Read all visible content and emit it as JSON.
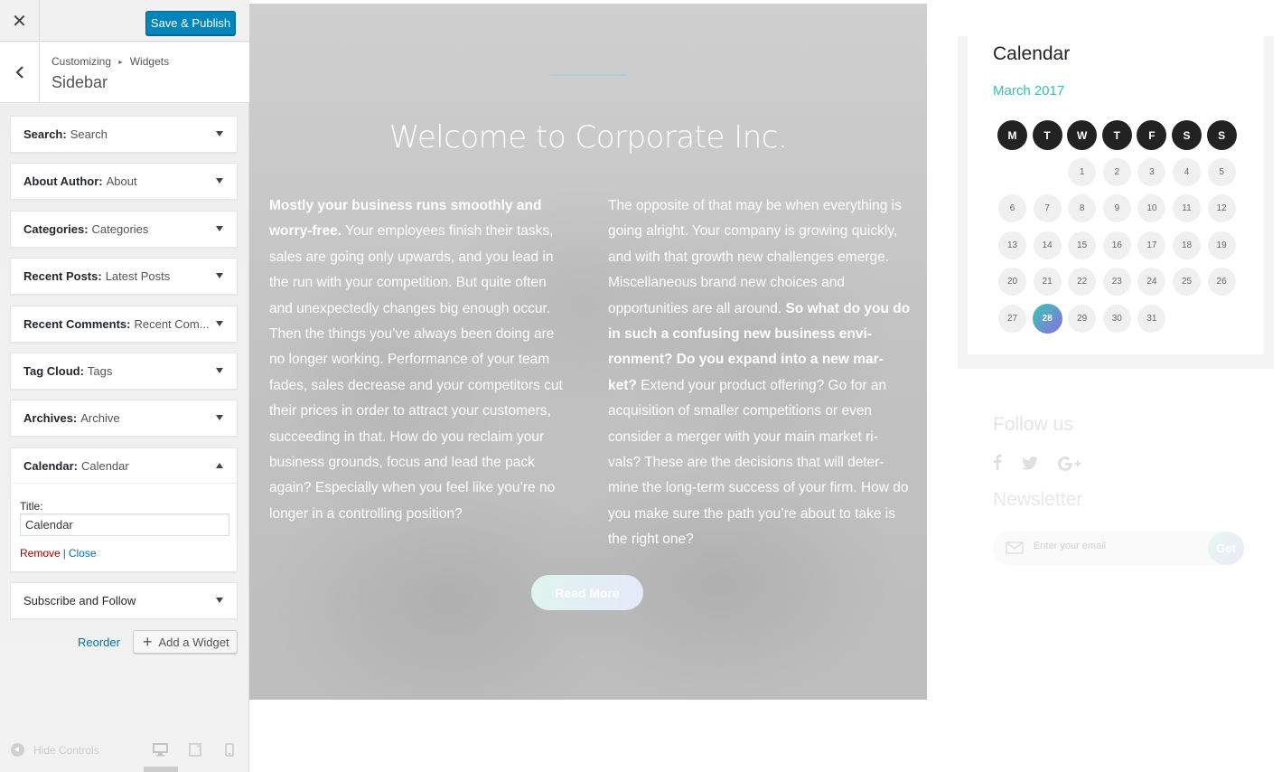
{
  "customizer": {
    "publish_label": "Save & Publish",
    "breadcrumb_customizing": "Customizing",
    "breadcrumb_widgets": "Widgets",
    "section_title": "Sidebar",
    "widgets": [
      {
        "type": "Search:",
        "title": "Search"
      },
      {
        "type": "About Author:",
        "title": "About"
      },
      {
        "type": "Categories:",
        "title": "Categories"
      },
      {
        "type": "Recent Posts:",
        "title": "Latest Posts"
      },
      {
        "type": "Recent Comments:",
        "title": "Recent Com..."
      },
      {
        "type": "Tag Cloud:",
        "title": "Tags"
      },
      {
        "type": "Archives:",
        "title": "Archive"
      },
      {
        "type": "Calendar:",
        "title": "Calendar"
      },
      {
        "type": "Subscribe and Follow",
        "title": ""
      }
    ],
    "calendar_form": {
      "title_label": "Title:",
      "title_value": "Calendar",
      "remove_label": "Remove",
      "separator": "|",
      "close_label": "Close"
    },
    "reorder_label": "Reorder",
    "add_widget_label": "Add a Widget",
    "hide_controls_label": "Hide Controls"
  },
  "hero": {
    "title": "Welcome to Corporate Inc.",
    "left_bold": "Mostly your business runs smoothly and worry-free.",
    "left_text": " Your employees finish their tasks, sales are going only upwards, and you lead in the run with your competition. But quite often and unexpectedly changes big enough occur. Then the things you’ve always been doing are no longer working. Performance of your team fades, sales decrease and your competitors cut their prices in order to attract your customers, succeeding in that. How do you reclaim your business grounds, focus and lead the pack again? Especially when you feel like you’re no longer in a controlling position?",
    "right_text_1": "The opposite of that may be when everything is going alright. Your company is growing quickly, and with that growth new challenges emerge. Miscellaneous brand new choices and opportunities are all around. ",
    "right_bold": "So what do you do in such a confusing new business envi-ronment? Do you expand into a new mar-ket?",
    "right_text_2": " Extend your product offering? Go for an acquisition of smaller competitions or even consider a merger with your main market ri-vals? These are the decisions that will deter-mine the long-term success of your firm. How do you make sure the path you’re about to take is the right one?",
    "read_more": "Read More"
  },
  "calendar": {
    "heading": "Calendar",
    "month": "March 2017",
    "weekdays": [
      "M",
      "T",
      "W",
      "T",
      "F",
      "S",
      "S"
    ],
    "days": [
      "1",
      "2",
      "3",
      "4",
      "5",
      "6",
      "7",
      "8",
      "9",
      "10",
      "11",
      "12",
      "13",
      "14",
      "15",
      "16",
      "17",
      "18",
      "19",
      "20",
      "21",
      "22",
      "23",
      "24",
      "25",
      "26",
      "27",
      "28",
      "29",
      "30",
      "31"
    ],
    "today": "28",
    "accent_color": "#2fc4b6"
  },
  "follow": {
    "heading": "Follow us",
    "icons": [
      "facebook-icon",
      "twitter-icon",
      "google-plus-icon"
    ]
  },
  "newsletter": {
    "heading": "Newsletter",
    "placeholder": "Enter your email",
    "button": "Get"
  },
  "colors": {
    "publish_button": "#0085ba",
    "link": "#0073aa",
    "remove_link": "#aa0000"
  }
}
